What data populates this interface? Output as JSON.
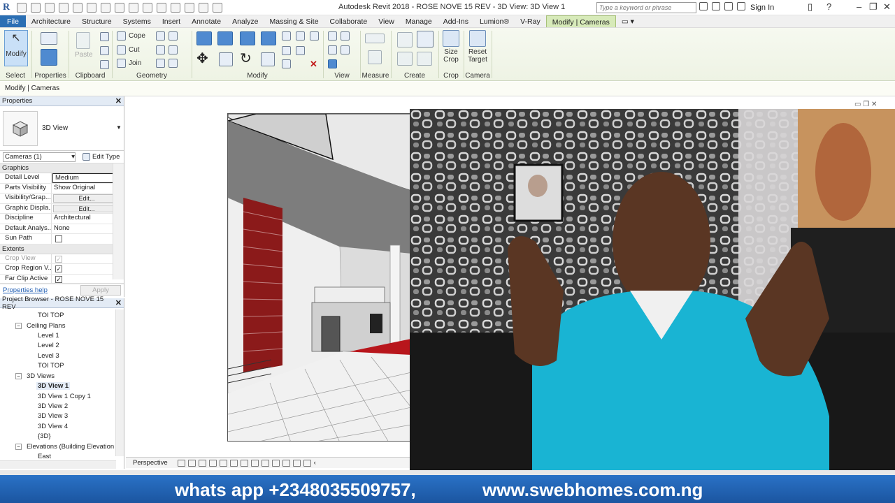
{
  "titlebar": {
    "app_title": "Autodesk Revit 2018 -    ROSE NOVE 15 REV - 3D View: 3D View 1",
    "search_placeholder": "Type a keyword or phrase",
    "sign_in": "Sign In"
  },
  "ribbon_tabs": [
    "File",
    "Architecture",
    "Structure",
    "Systems",
    "Insert",
    "Annotate",
    "Analyze",
    "Massing & Site",
    "Collaborate",
    "View",
    "Manage",
    "Add-Ins",
    "Lumion®",
    "V-Ray",
    "Modify | Cameras"
  ],
  "ribbon": {
    "select": {
      "modify": "Modify",
      "label": "Select"
    },
    "properties": {
      "label": "Properties"
    },
    "clipboard": {
      "paste": "Paste",
      "label": "Clipboard"
    },
    "geometry": {
      "cope": "Cope",
      "cut": "Cut",
      "join": "Join",
      "label": "Geometry"
    },
    "modify": {
      "label": "Modify"
    },
    "view": {
      "label": "View"
    },
    "measure": {
      "label": "Measure"
    },
    "create": {
      "label": "Create"
    },
    "crop": {
      "size_crop": "Size Crop",
      "label": "Crop"
    },
    "camera": {
      "reset_target": "Reset Target",
      "label": "Camera"
    }
  },
  "context_bar": "Modify | Cameras",
  "properties": {
    "title": "Properties",
    "type_name": "3D View",
    "instance": "Cameras (1)",
    "edit_type": "Edit Type",
    "groups": {
      "graphics": "Graphics",
      "extents": "Extents"
    },
    "rows": [
      {
        "key": "Detail Level",
        "value": "Medium"
      },
      {
        "key": "Parts Visibility",
        "value": "Show Original"
      },
      {
        "key": "Visibility/Grap...",
        "value": "Edit..."
      },
      {
        "key": "Graphic Displa...",
        "value": "Edit..."
      },
      {
        "key": "Discipline",
        "value": "Architectural"
      },
      {
        "key": "Default Analys...",
        "value": "None"
      },
      {
        "key": "Sun Path",
        "value": ""
      }
    ],
    "extents_rows": [
      {
        "key": "Crop View"
      },
      {
        "key": "Crop Region V..."
      },
      {
        "key": "Far Clip Active"
      }
    ],
    "help": "Properties help",
    "apply": "Apply"
  },
  "browser": {
    "title": "Project Browser - ROSE NOVE 15 REV",
    "items": [
      "TOI TOP",
      "Ceiling Plans",
      "Level 1",
      "Level 2",
      "Level 3",
      "TOI TOP",
      "3D Views",
      "3D View 1",
      "3D View 1 Copy 1",
      "3D View 2",
      "3D View 3",
      "3D View 4",
      "{3D}",
      "Elevations (Building Elevation",
      "East"
    ]
  },
  "view_status": {
    "mode": "Perspective"
  },
  "banner": {
    "phone": "whats app +2348035509757,",
    "website": "www.swebhomes.com.ng"
  }
}
